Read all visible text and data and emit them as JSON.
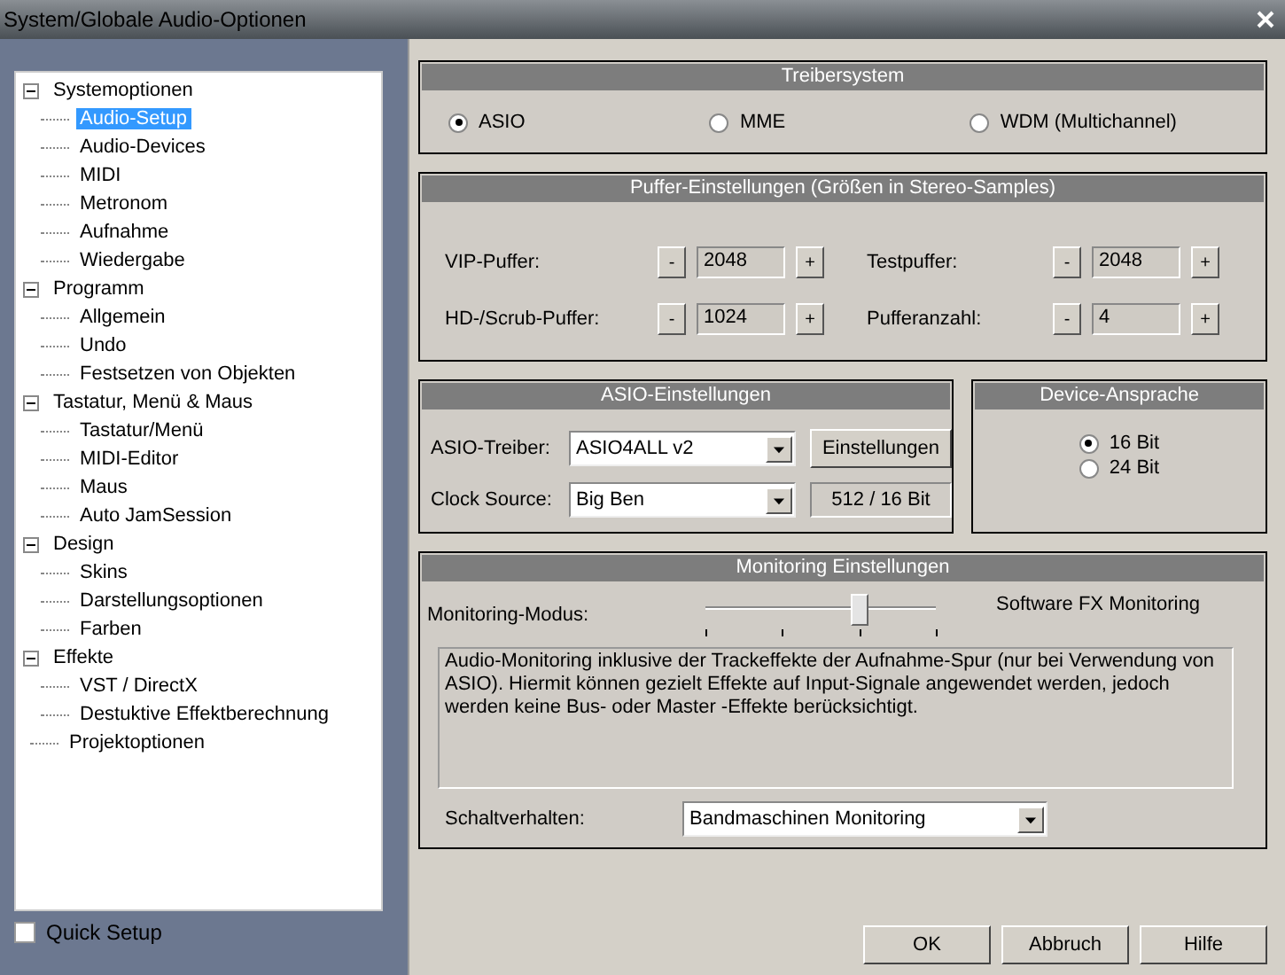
{
  "window": {
    "title": "System/Globale Audio-Optionen"
  },
  "tree": [
    {
      "label": "Systemoptionen",
      "expanded": true,
      "selected": false,
      "children": [
        {
          "label": "Audio-Setup",
          "selected": true
        },
        {
          "label": "Audio-Devices",
          "selected": false
        },
        {
          "label": "MIDI",
          "selected": false
        },
        {
          "label": "Metronom",
          "selected": false
        },
        {
          "label": "Aufnahme",
          "selected": false
        },
        {
          "label": "Wiedergabe",
          "selected": false
        }
      ]
    },
    {
      "label": "Programm",
      "expanded": true,
      "selected": false,
      "children": [
        {
          "label": "Allgemein",
          "selected": false
        },
        {
          "label": "Undo",
          "selected": false
        },
        {
          "label": "Festsetzen von Objekten",
          "selected": false
        }
      ]
    },
    {
      "label": "Tastatur, Menü & Maus",
      "expanded": true,
      "selected": false,
      "children": [
        {
          "label": "Tastatur/Menü",
          "selected": false
        },
        {
          "label": "MIDI-Editor",
          "selected": false
        },
        {
          "label": "Maus",
          "selected": false
        },
        {
          "label": "Auto JamSession",
          "selected": false
        }
      ]
    },
    {
      "label": "Design",
      "expanded": true,
      "selected": false,
      "children": [
        {
          "label": "Skins",
          "selected": false
        },
        {
          "label": "Darstellungsoptionen",
          "selected": false
        },
        {
          "label": "Farben",
          "selected": false
        }
      ]
    },
    {
      "label": "Effekte",
      "expanded": true,
      "selected": false,
      "children": [
        {
          "label": "VST / DirectX",
          "selected": false
        },
        {
          "label": "Destuktive Effektberechnung",
          "selected": false
        }
      ]
    },
    {
      "label": "Projektoptionen",
      "selected": false
    }
  ],
  "quick_setup": {
    "label": "Quick Setup",
    "checked": false
  },
  "driver_system": {
    "title": "Treibersystem",
    "options": [
      {
        "label": "ASIO",
        "selected": true
      },
      {
        "label": "MME",
        "selected": false
      },
      {
        "label": "WDM (Multichannel)",
        "selected": false
      }
    ]
  },
  "buffer": {
    "title": "Puffer-Einstellungen (Größen in Stereo-Samples)",
    "fields": [
      {
        "label": "VIP-Puffer:",
        "value": "2048",
        "minus": "-",
        "plus": "+"
      },
      {
        "label": "Testpuffer:",
        "value": "2048",
        "minus": "-",
        "plus": "+"
      },
      {
        "label": "HD-/Scrub-Puffer:",
        "value": "1024",
        "minus": "-",
        "plus": "+"
      },
      {
        "label": "Pufferanzahl:",
        "value": "4",
        "minus": "-",
        "plus": "+"
      }
    ]
  },
  "asio": {
    "title": "ASIO-Einstellungen",
    "driver_label": "ASIO-Treiber:",
    "driver_value": "ASIO4ALL v2",
    "settings_button": "Einstellungen",
    "clock_label": "Clock Source:",
    "clock_value": "Big Ben",
    "info": "512 / 16 Bit"
  },
  "device": {
    "title": "Device-Ansprache",
    "options": [
      {
        "label": "16 Bit",
        "selected": true
      },
      {
        "label": "24 Bit",
        "selected": false
      }
    ]
  },
  "monitoring": {
    "title": "Monitoring Einstellungen",
    "mode_label": "Monitoring-Modus:",
    "mode_value": "Software FX Monitoring",
    "level": 0.667,
    "description": "Audio-Monitoring inklusive der Trackeffekte der Aufnahme-Spur (nur bei Verwendung von ASIO). Hiermit können gezielt Effekte auf Input-Signale angewendet werden, jedoch werden keine Bus- oder Master -Effekte berücksichtigt.",
    "switch_label": "Schaltverhalten:",
    "switch_value": "Bandmaschinen Monitoring"
  },
  "buttons": [
    "OK",
    "Abbruch",
    "Hilfe"
  ]
}
